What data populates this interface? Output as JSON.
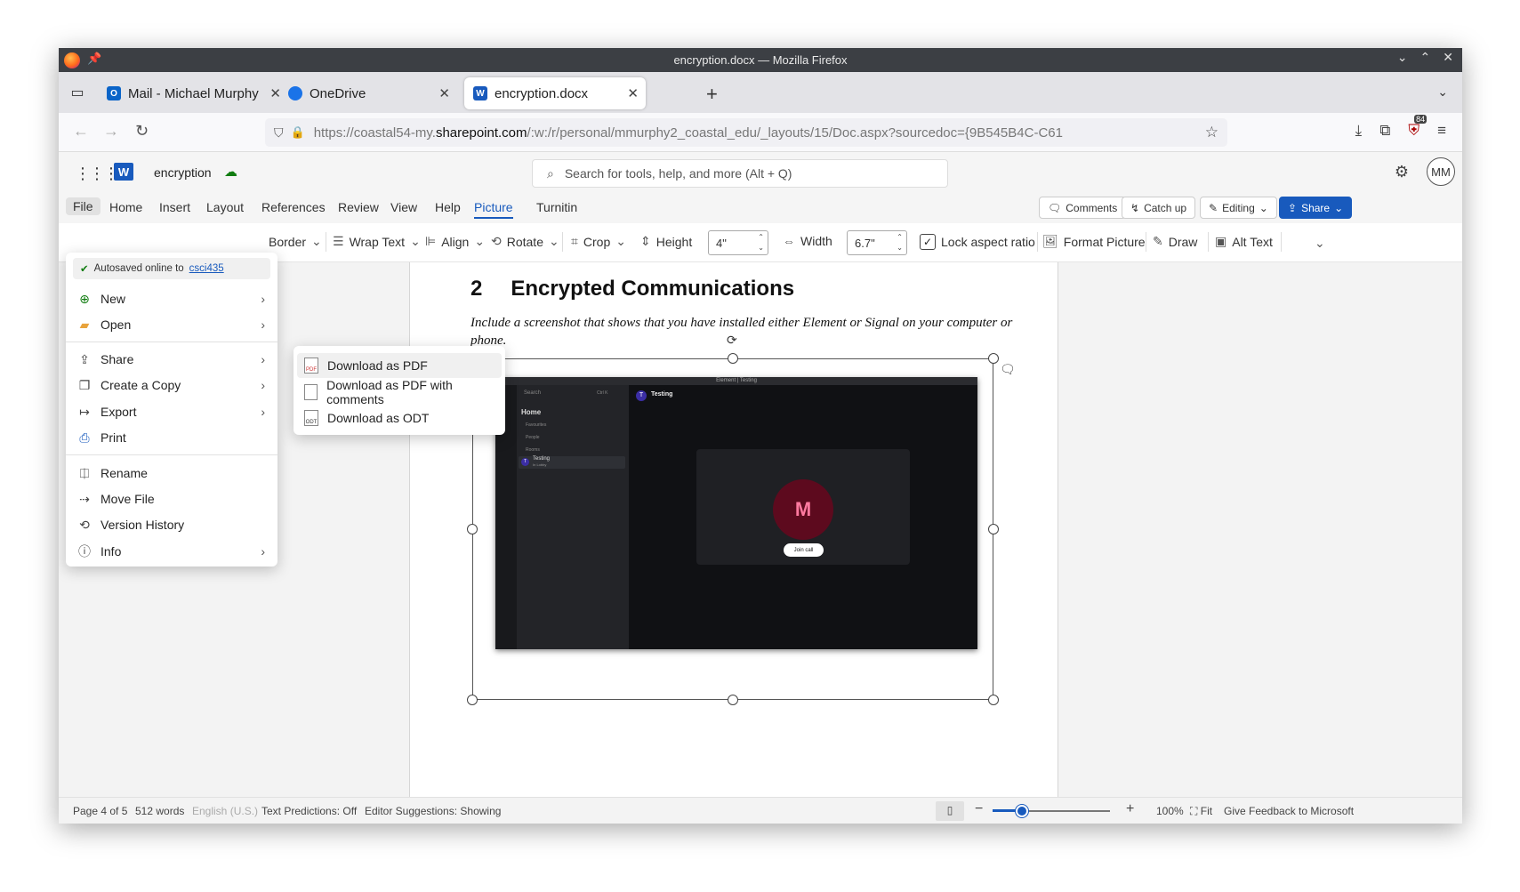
{
  "window": {
    "title": "encryption.docx — Mozilla Firefox"
  },
  "tabs": [
    {
      "label": "Mail - Michael Murphy",
      "icon": "outlook-icon"
    },
    {
      "label": "OneDrive",
      "icon": "onedrive-icon"
    },
    {
      "label": "encryption.docx",
      "icon": "word-icon",
      "active": true
    }
  ],
  "url": {
    "prefix": "https://coastal54-my.",
    "domain": "sharepoint.com",
    "path": "/:w:/r/personal/mmurphy2_coastal_edu/_layouts/15/Doc.aspx?sourcedoc={9B545B4C-C61"
  },
  "extension_badge": "84",
  "app": {
    "doc_name": "encryption",
    "search_placeholder": "Search for tools, help, and more (Alt + Q)",
    "avatar": "MM"
  },
  "menubar": {
    "tabs": [
      "File",
      "Home",
      "Insert",
      "Layout",
      "References",
      "Review",
      "View",
      "Help",
      "Picture",
      "Turnitin"
    ],
    "active": "Picture",
    "comments": "Comments",
    "catchup": "Catch up",
    "editing": "Editing",
    "share": "Share"
  },
  "ribbon": {
    "border": "Border",
    "wrap_text": "Wrap Text",
    "align": "Align",
    "rotate": "Rotate",
    "crop": "Crop",
    "height_label": "Height",
    "height_value": "4\"",
    "width_label": "Width",
    "width_value": "6.7\"",
    "lock_aspect": "Lock aspect ratio",
    "format_picture": "Format Picture",
    "draw": "Draw",
    "alt_text": "Alt Text"
  },
  "document": {
    "heading_num": "2",
    "heading_text": "Encrypted Communications",
    "paragraph": "Include a screenshot that shows that you have installed either Element or Signal on your computer or phone."
  },
  "embedded_screenshot": {
    "title": "Element | Testing",
    "room_header": "Testing",
    "sidebar_home": "Home",
    "sidebar_sections": [
      "Favourites",
      "People",
      "Rooms"
    ],
    "room_item": "Testing",
    "room_sub": "In Lobby",
    "search": "Search",
    "shortcut": "Ctrl K",
    "avatar_letter": "M",
    "join_call": "Join call"
  },
  "file_menu": {
    "autosaved_text": "Autosaved online to",
    "autosaved_link": "csci435",
    "items": [
      {
        "label": "New",
        "icon": "plus-circle-icon",
        "has_sub": true
      },
      {
        "label": "Open",
        "icon": "folder-icon",
        "has_sub": true
      },
      {
        "label": "Share",
        "icon": "share-icon",
        "has_sub": true
      },
      {
        "label": "Create a Copy",
        "icon": "copy-icon",
        "has_sub": true
      },
      {
        "label": "Export",
        "icon": "export-icon",
        "has_sub": true
      },
      {
        "label": "Print",
        "icon": "printer-icon",
        "has_sub": false
      },
      {
        "label": "Rename",
        "icon": "rename-icon",
        "has_sub": false
      },
      {
        "label": "Move File",
        "icon": "move-file-icon",
        "has_sub": false
      },
      {
        "label": "Version History",
        "icon": "history-icon",
        "has_sub": false
      },
      {
        "label": "Info",
        "icon": "info-icon",
        "has_sub": true
      }
    ]
  },
  "export_submenu": [
    {
      "label": "Download as PDF",
      "icon_text": "PDF"
    },
    {
      "label": "Download as PDF with comments",
      "icon_text": ""
    },
    {
      "label": "Download as ODT",
      "icon_text": "ODT"
    }
  ],
  "statusbar": {
    "page": "Page 4 of 5",
    "words": "512 words",
    "language": "English (U.S.)",
    "predictions": "Text Predictions: Off",
    "editor": "Editor Suggestions: Showing",
    "zoom": "100%",
    "zoom_level": 0.25,
    "fit": "Fit",
    "feedback": "Give Feedback to Microsoft"
  },
  "colors": {
    "accent": "#185abd",
    "word_blue": "#185abd",
    "saved_green": "#107c10"
  }
}
